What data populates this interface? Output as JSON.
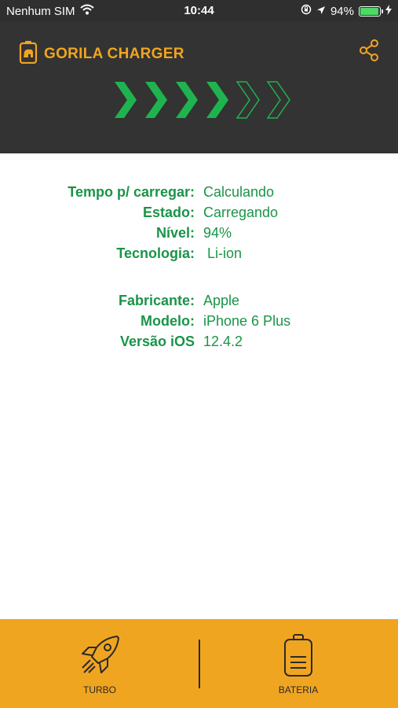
{
  "status_bar": {
    "carrier": "Nenhum SIM",
    "time": "10:44",
    "battery_percent": "94%",
    "battery_level": 0.94,
    "icons": [
      "wifi-icon",
      "orientation-lock-icon",
      "location-icon",
      "battery-icon",
      "charging-bolt-icon"
    ]
  },
  "header": {
    "title": "GORILA CHARGER",
    "logo": "gorilla-battery-logo-icon",
    "share_icon": "share-icon",
    "charge_progress": {
      "filled": 4,
      "total": 6
    }
  },
  "info": {
    "battery": [
      {
        "label": "Tempo p/ carregar:",
        "value": "Calculando"
      },
      {
        "label": "Estado:",
        "value": "Carregando"
      },
      {
        "label": "Nível:",
        "value": "94%"
      },
      {
        "label": "Tecnologia:",
        "value": " Li-ion"
      }
    ],
    "device": [
      {
        "label": "Fabricante:",
        "value": "Apple"
      },
      {
        "label": "Modelo:",
        "value": "iPhone 6 Plus"
      },
      {
        "label": "Versão iOS",
        "value": "12.4.2"
      }
    ]
  },
  "tabs": [
    {
      "label": "TURBO",
      "icon": "rocket-icon"
    },
    {
      "label": "BATERIA",
      "icon": "battery-icon"
    }
  ],
  "colors": {
    "accent": "#f0a521",
    "header_bg": "#333333",
    "green": "#1a9448",
    "chevron_filled": "#1fb34f"
  }
}
